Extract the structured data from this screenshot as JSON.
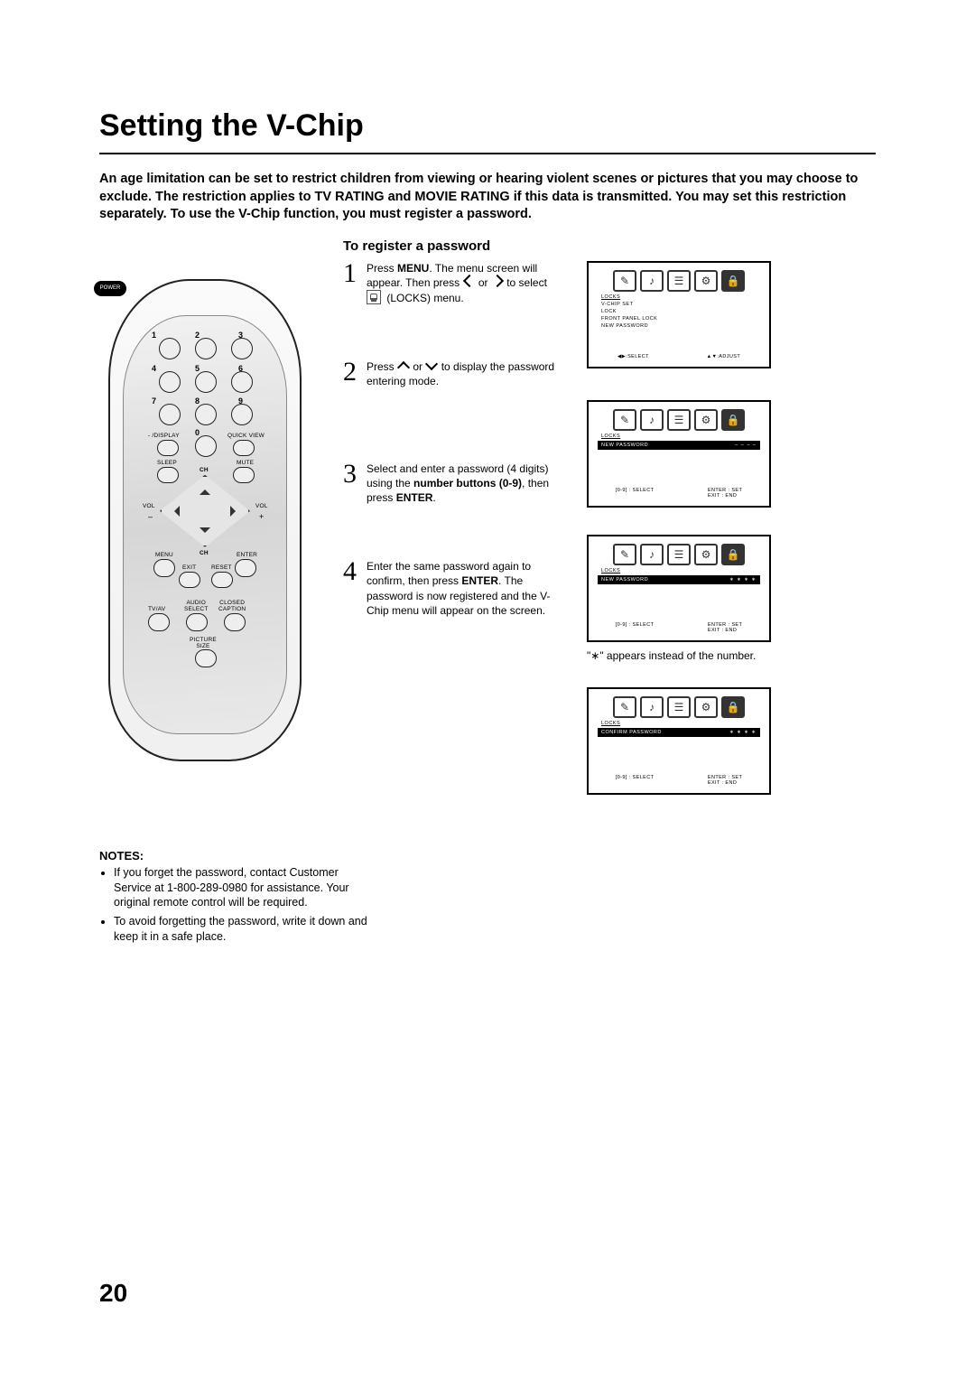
{
  "title": "Setting the V-Chip",
  "intro": "An age limitation can be set to restrict children from viewing or hearing violent scenes or pictures that you may choose to exclude.  The restriction applies to  TV RATING   and  MOVIE RATING   if this data is transmitted.  You may set this restriction separately.  To use the V-Chip function, you must register a password.",
  "subhead": "To register a password",
  "remote": {
    "power": "POWER",
    "nums": [
      "1",
      "2",
      "3",
      "4",
      "5",
      "6",
      "7",
      "8",
      "9",
      "0"
    ],
    "display": "- /DISPLAY",
    "quick": "QUICK VIEW",
    "sleep": "SLEEP",
    "mute": "MUTE",
    "ch": "CH",
    "vol_minus_top": "VOL",
    "vol_minus_bot": "–",
    "vol_plus_top": "VOL",
    "vol_plus_bot": "+",
    "menu": "MENU",
    "enter": "ENTER",
    "exit": "EXIT",
    "reset": "RESET",
    "tvav": "TV/AV",
    "audio": "AUDIO\nSELECT",
    "cc": "CLOSED\nCAPTION",
    "pic": "PICTURE\nSIZE"
  },
  "steps": [
    {
      "n": "1",
      "p1": "Press ",
      "b1": "MENU",
      "p2": ". The menu screen will appear. Then press ",
      "p3": " or ",
      "p4": " to select ",
      "p5": " (LOCKS) menu."
    },
    {
      "n": "2",
      "p1": "Press ",
      "p2": " or ",
      "p3": " to display the password entering mode."
    },
    {
      "n": "3",
      "p1": "Select and enter a password (4 digits) using the ",
      "b1": "number buttons (0-9)",
      "p2": ", then press ",
      "b2": "ENTER",
      "p3": "."
    },
    {
      "n": "4",
      "p1": "Enter the same password again to confirm, then press ",
      "b1": "ENTER",
      "p2": ". The password is now registered and the V-Chip menu will appear on the screen."
    }
  ],
  "screens": {
    "locks": "LOCKS",
    "s1": {
      "lines": [
        "V-CHIP SET",
        "LOCK",
        "FRONT PANEL LOCK",
        "NEW PASSWORD"
      ],
      "foot_l": "◀▶:SELECT",
      "foot_r": "▲▼:ADJUST"
    },
    "s2": {
      "hi": "NEW PASSWORD",
      "dashes": "– – – –",
      "foot_l": "[0-9] : SELECT",
      "foot_r1": "ENTER : SET",
      "foot_r2": "EXIT : END"
    },
    "s3": {
      "hi": "NEW PASSWORD",
      "stars": "∗ ∗ ∗ ∗",
      "foot_l": "[0-9] : SELECT",
      "foot_r1": "ENTER : SET",
      "foot_r2": "EXIT : END"
    },
    "s4": {
      "hi": "CONFIRM PASSWORD",
      "stars": "∗ ∗ ∗ ∗",
      "foot_l": "[0-9] : SELECT",
      "foot_r1": "ENTER : SET",
      "foot_r2": "EXIT : END"
    }
  },
  "asterisk_note": "\"∗\" appears instead of the number.",
  "notes_head": "NOTES:",
  "notes": [
    "If you forget the password, contact Customer Service at 1-800-289-0980 for assistance. Your original remote control will be required.",
    "To avoid forgetting the password, write it down and keep it in a safe place."
  ],
  "page_number": "20"
}
